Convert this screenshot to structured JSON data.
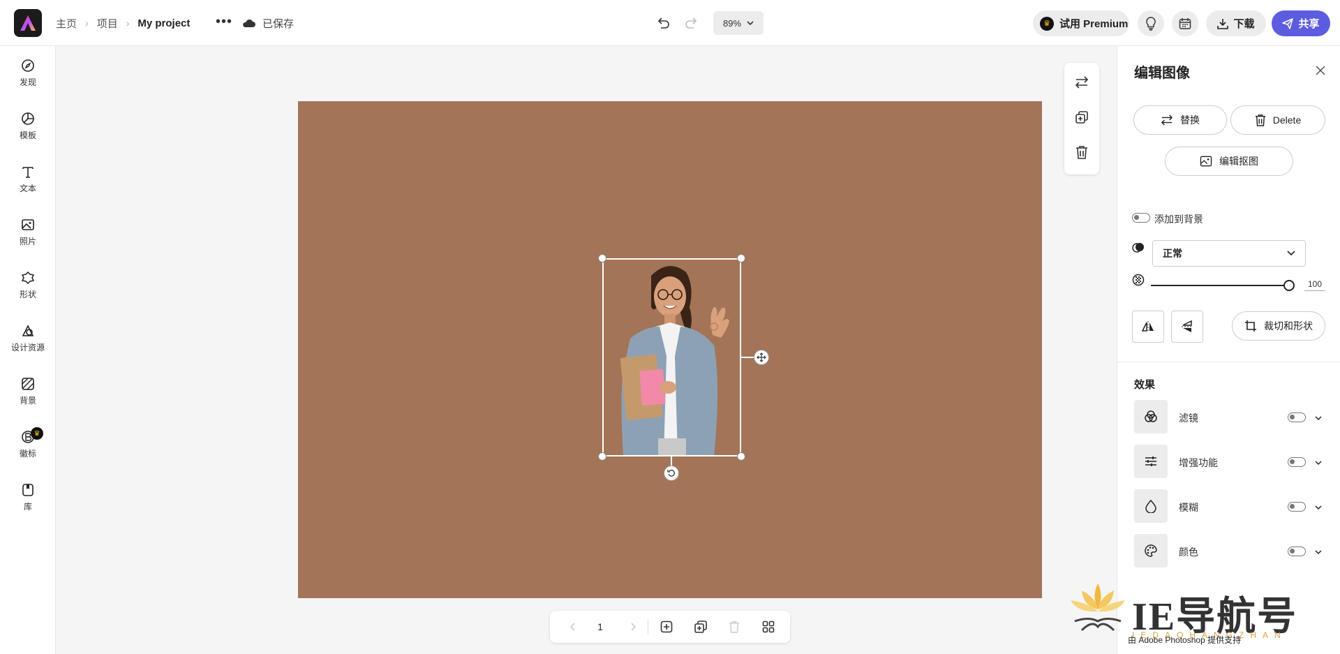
{
  "header": {
    "breadcrumbs": [
      "主页",
      "项目",
      "My project"
    ],
    "more_label": "•••",
    "saved_label": "已保存",
    "zoom": "89%",
    "premium_label": "试用 Premium",
    "download_label": "下载",
    "share_label": "共享"
  },
  "left_rail": {
    "items": [
      {
        "label": "发现",
        "icon": "discover-icon"
      },
      {
        "label": "模板",
        "icon": "templates-icon"
      },
      {
        "label": "文本",
        "icon": "text-icon"
      },
      {
        "label": "照片",
        "icon": "photos-icon"
      },
      {
        "label": "形状",
        "icon": "shapes-icon"
      },
      {
        "label": "设计资源",
        "icon": "design-assets-icon"
      },
      {
        "label": "背景",
        "icon": "background-icon"
      },
      {
        "label": "徽标",
        "icon": "logo-icon"
      },
      {
        "label": "库",
        "icon": "library-icon"
      }
    ]
  },
  "canvas": {
    "background_color": "#a37457"
  },
  "page_controls": {
    "page_number": "1"
  },
  "right_panel": {
    "title": "编辑图像",
    "replace_label": "替换",
    "delete_label": "Delete",
    "edit_cutout_label": "编辑抠图",
    "add_to_background_label": "添加到背景",
    "blend_mode": "正常",
    "opacity_value": "100",
    "crop_label": "裁切和形状",
    "effects_title": "效果",
    "effects": [
      {
        "label": "滤镜",
        "icon": "filter-icon"
      },
      {
        "label": "增强功能",
        "icon": "adjust-icon"
      },
      {
        "label": "模糊",
        "icon": "blur-icon"
      },
      {
        "label": "颜色",
        "icon": "color-palette-icon"
      }
    ]
  },
  "watermark": {
    "text": "IE导航号",
    "sub": "IEDAOHANGZHAN"
  },
  "powered_by": "由 Adobe Photoshop 提供支持",
  "colors": {
    "accent": "#5c5ce0",
    "canvas_bg": "#a37457"
  }
}
